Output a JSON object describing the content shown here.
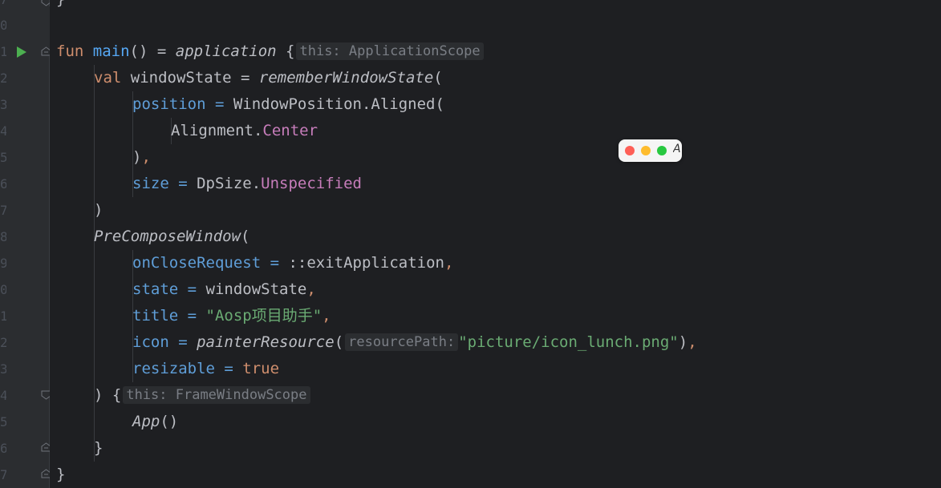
{
  "gutter": {
    "line_numbers": [
      "7",
      "0",
      "1",
      "2",
      "3",
      "4",
      "5",
      "6",
      "7",
      "8",
      "9",
      "0",
      "1",
      "2",
      "3",
      "4",
      "5",
      "6",
      "7"
    ]
  },
  "code": {
    "l0": {
      "brace": "}"
    },
    "l2": {
      "kw": "fun",
      "fn": "main",
      "paren": "() = ",
      "call": "application",
      "brace": " {",
      "hint": "this: ApplicationScope"
    },
    "l3": {
      "kw": "val",
      "name": " windowState = ",
      "call": "rememberWindowState",
      "paren": "("
    },
    "l4": {
      "param": "position",
      "eq": " = ",
      "cls": "WindowPosition.Aligned("
    },
    "l5": {
      "cls": "Alignment.",
      "enum": "Center"
    },
    "l6": {
      "paren": ")",
      "comma": ","
    },
    "l7": {
      "param": "size",
      "eq": " = ",
      "cls": "DpSize.",
      "enum": "Unspecified"
    },
    "l8": {
      "paren": ")"
    },
    "l9": {
      "call": "PreComposeWindow",
      "paren": "("
    },
    "l10": {
      "param": "onCloseRequest",
      "eq": " = ",
      "val": "::exitApplication",
      "comma": ","
    },
    "l11": {
      "param": "state",
      "eq": " = ",
      "val": "windowState",
      "comma": ","
    },
    "l12": {
      "param": "title",
      "eq": " = ",
      "str": "\"Aosp项目助手\"",
      "comma": ","
    },
    "l13": {
      "param": "icon",
      "eq": " = ",
      "call": "painterResource",
      "paren": "(",
      "hint": "resourcePath:",
      "str": "\"picture/icon_lunch.png\"",
      "close": ")",
      "comma": ","
    },
    "l14": {
      "param": "resizable",
      "eq": " = ",
      "kw": "true"
    },
    "l15": {
      "paren": ") {",
      "hint": "this: FrameWindowScope"
    },
    "l16": {
      "call": "App",
      "paren": "()"
    },
    "l17": {
      "brace": "}"
    },
    "l18": {
      "brace": "}"
    }
  },
  "mac_widget": {
    "letter": "A"
  },
  "colors": {
    "background": "#1e1f22",
    "gutter": "#2b2d30",
    "keyword": "#cf8e6d",
    "function": "#56a8f5",
    "parameter": "#5f9ed8",
    "enum": "#c77dbb",
    "string": "#6aab73",
    "text": "#bcbec4"
  }
}
